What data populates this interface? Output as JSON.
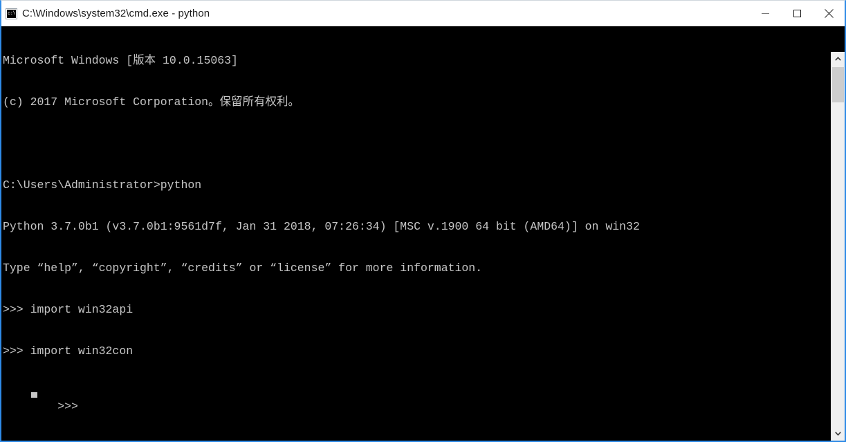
{
  "window": {
    "title": "C:\\Windows\\system32\\cmd.exe - python",
    "icon_name": "cmd-exe-icon",
    "icon_glyph": "c:\\",
    "border_color": "#2e8ae6",
    "titlebar_bg": "#ffffff",
    "title_color": "#1b1b1b"
  },
  "controls": {
    "minimize_label": "Minimize",
    "maximize_label": "Maximize",
    "close_label": "Close"
  },
  "console": {
    "background": "#000000",
    "foreground": "#c6c6c6",
    "lines": [
      "Microsoft Windows [版本 10.0.15063]",
      "(c) 2017 Microsoft Corporation。保留所有权利。",
      "",
      "C:\\Users\\Administrator>python",
      "Python 3.7.0b1 (v3.7.0b1:9561d7f, Jan 31 2018, 07:26:34) [MSC v.1900 64 bit (AMD64)] on win32",
      "Type “help”, “copyright”, “credits” or “license” for more information.",
      ">>> import win32api",
      ">>> import win32con"
    ],
    "prompt": ">>> ",
    "cursor": "block"
  },
  "scrollbar": {
    "up_arrow": "scroll-up-arrow",
    "down_arrow": "scroll-down-arrow",
    "thumb_color": "#cdcdcd",
    "track_color": "#f0f0f0"
  }
}
